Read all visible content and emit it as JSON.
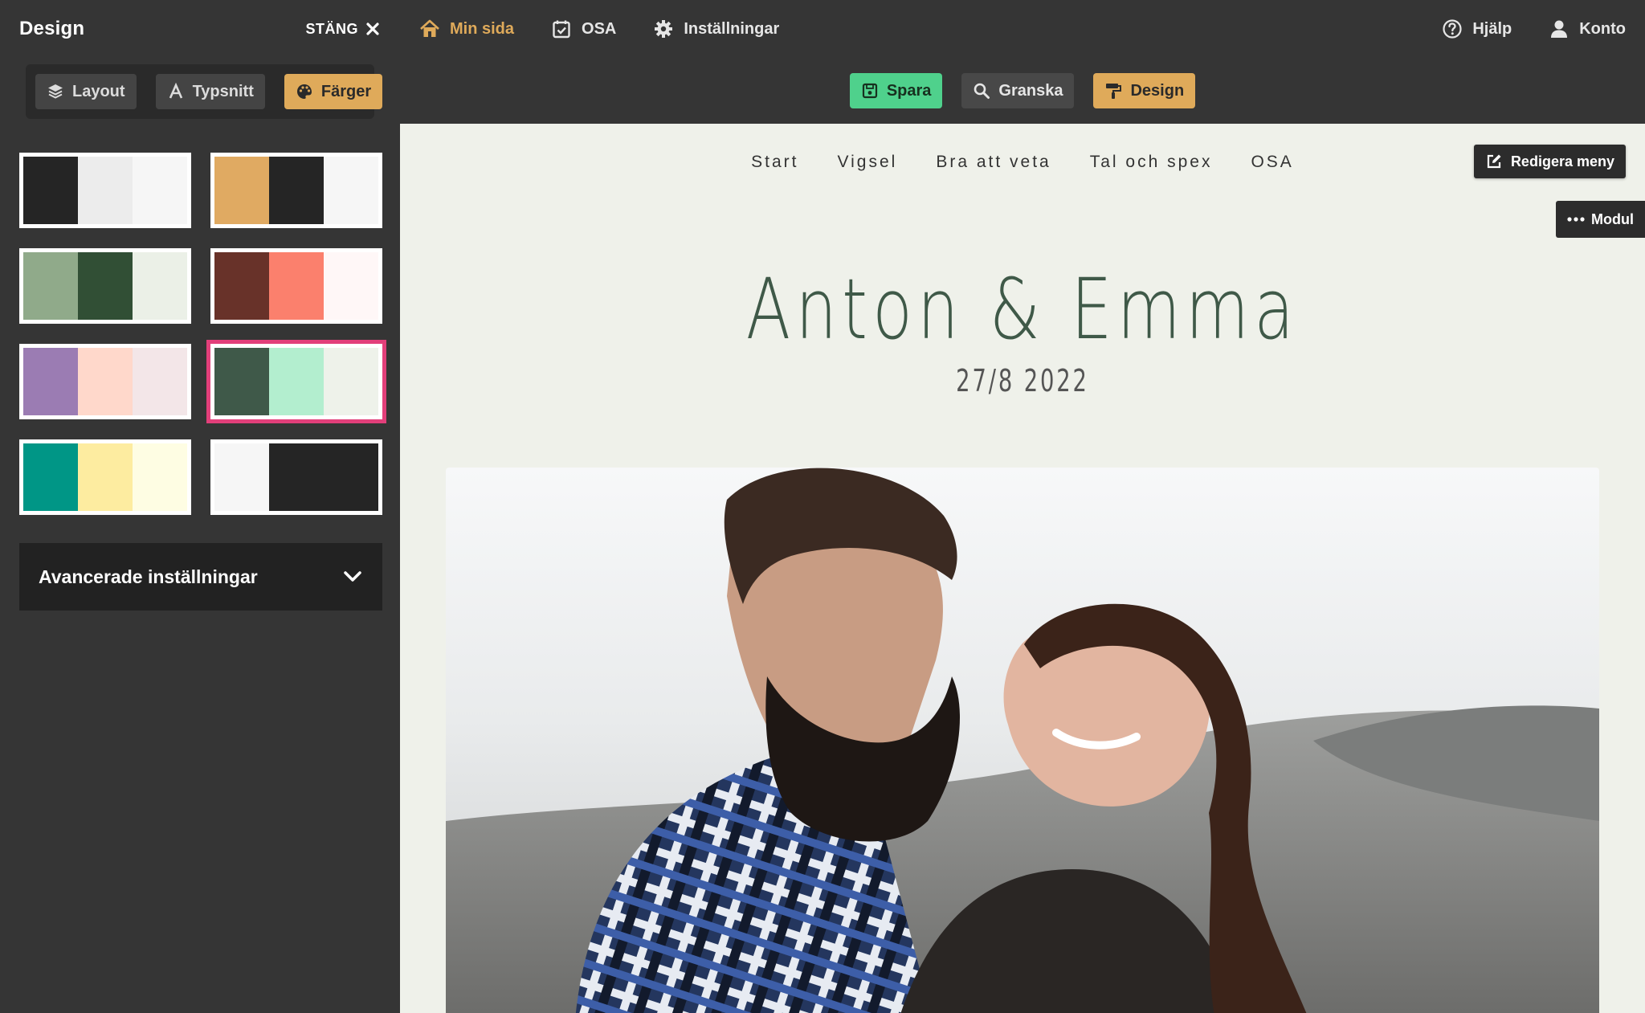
{
  "sidebar": {
    "title": "Design",
    "close_label": "STÄNG",
    "tabs": [
      {
        "label": "Layout",
        "icon": "layers-icon"
      },
      {
        "label": "Typsnitt",
        "icon": "font-icon"
      },
      {
        "label": "Färger",
        "icon": "palette-icon",
        "active": true
      }
    ],
    "palettes": [
      {
        "colors": [
          "#252525",
          "#ececec",
          "#f6f6f6"
        ]
      },
      {
        "colors": [
          "#e0aa62",
          "#252525",
          "#f6f6f6"
        ]
      },
      {
        "colors": [
          "#90aa8a",
          "#314f35",
          "#ebf0e7"
        ]
      },
      {
        "colors": [
          "#683229",
          "#fb806d",
          "#fff7f7"
        ]
      },
      {
        "colors": [
          "#9b7cb3",
          "#ffd8cb",
          "#f3e6e8"
        ]
      },
      {
        "colors": [
          "#3f5949",
          "#b3eecf",
          "#eef2ea"
        ],
        "selected": true
      },
      {
        "colors": [
          "#009686",
          "#fdeca0",
          "#fefde3"
        ]
      },
      {
        "colors": [
          "#f6f6f6",
          "#252525",
          "#252525"
        ]
      }
    ],
    "advanced_label": "Avancerade inställningar"
  },
  "topnav": {
    "left": [
      {
        "label": "Min sida",
        "icon": "home-icon",
        "active": true
      },
      {
        "label": "OSA",
        "icon": "calendar-check-icon"
      },
      {
        "label": "Inställningar",
        "icon": "gear-icon"
      }
    ],
    "right": [
      {
        "label": "Hjälp",
        "icon": "help-circle-icon"
      },
      {
        "label": "Konto",
        "icon": "user-icon"
      }
    ]
  },
  "toolbar": {
    "save": "Spara",
    "preview": "Granska",
    "design": "Design"
  },
  "site": {
    "menu": [
      "Start",
      "Vigsel",
      "Bra att veta",
      "Tal och spex",
      "OSA"
    ],
    "edit_menu_label": "Redigera meny",
    "module_label": "Modul",
    "names": "Anton & Emma",
    "date": "27/8 2022"
  },
  "colors": {
    "chrome": "#353535",
    "accent_gold": "#dfaa5a",
    "accent_green": "#4fd18c",
    "selected_outline": "#e23f7a",
    "canvas_bg": "#eff1ea",
    "title_green": "#3f5948"
  }
}
